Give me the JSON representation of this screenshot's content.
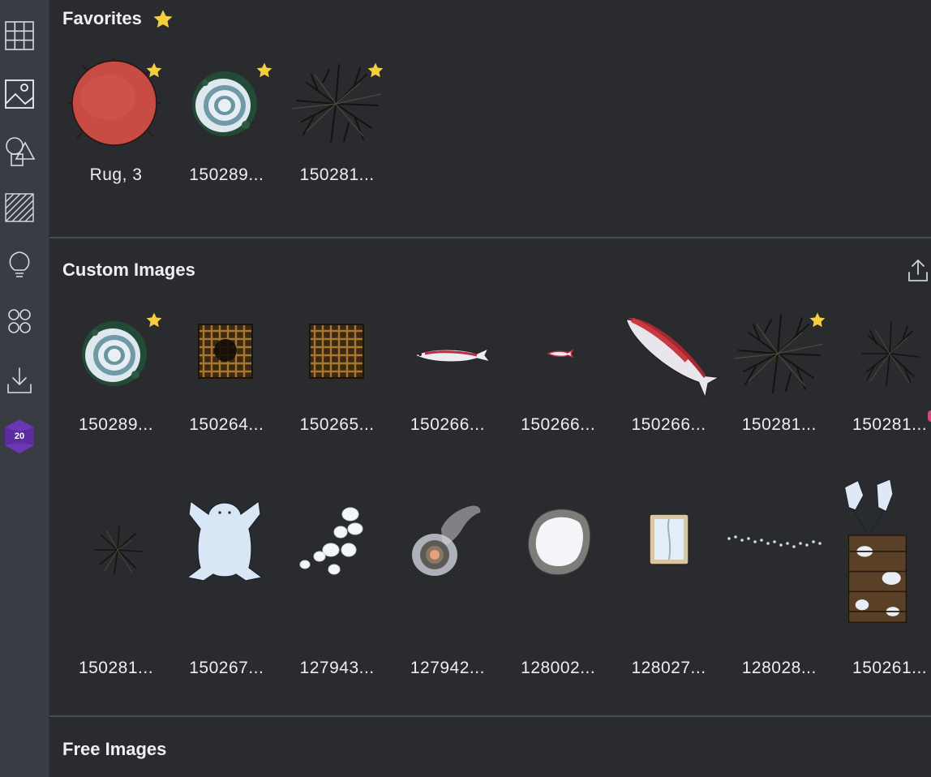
{
  "sidebar": {
    "items": [
      {
        "name": "grid-icon"
      },
      {
        "name": "image-icon"
      },
      {
        "name": "shapes-icon"
      },
      {
        "name": "hatch-pattern-icon"
      },
      {
        "name": "lightbulb-icon"
      },
      {
        "name": "circles-icon"
      },
      {
        "name": "download-icon"
      }
    ],
    "badge": "20"
  },
  "favorites": {
    "title": "Favorites",
    "items": [
      {
        "label": "Rug, 3",
        "icon": "red-rug",
        "favorite": true
      },
      {
        "label": "150289...",
        "icon": "snowy-bush",
        "favorite": true
      },
      {
        "label": "150281...",
        "icon": "dead-tree",
        "favorite": true
      }
    ]
  },
  "custom_images": {
    "title": "Custom Images",
    "upload_icon": "upload-icon",
    "items": [
      {
        "label": "150289...",
        "icon": "snowy-bush",
        "favorite": true
      },
      {
        "label": "150264...",
        "icon": "wooden-grate-hole",
        "favorite": false
      },
      {
        "label": "150265...",
        "icon": "wooden-grate",
        "favorite": false
      },
      {
        "label": "150266...",
        "icon": "fish",
        "favorite": false
      },
      {
        "label": "150266...",
        "icon": "small-fish",
        "favorite": false
      },
      {
        "label": "150266...",
        "icon": "large-red-fish",
        "favorite": false
      },
      {
        "label": "150281...",
        "icon": "dead-tree",
        "favorite": true
      },
      {
        "label": "150281...",
        "icon": "dead-tree-small",
        "favorite": false
      },
      {
        "label": "150281...",
        "icon": "dead-shrub",
        "favorite": false
      },
      {
        "label": "150267...",
        "icon": "polar-bear-rug",
        "favorite": false
      },
      {
        "label": "127943...",
        "icon": "snow-rocks",
        "favorite": false
      },
      {
        "label": "127942...",
        "icon": "campfire-smoke",
        "favorite": false
      },
      {
        "label": "128002...",
        "icon": "snow-boulder",
        "favorite": false
      },
      {
        "label": "128027...",
        "icon": "snow-crate",
        "favorite": false
      },
      {
        "label": "128028...",
        "icon": "footprints",
        "favorite": false
      },
      {
        "label": "150261...",
        "icon": "sled-cart",
        "favorite": false
      }
    ]
  },
  "free_images": {
    "title": "Free Images"
  },
  "colors": {
    "background": "#2a2b2f",
    "sidebar": "#3a3c43",
    "star": "#f3cf3e",
    "badge": "#5b2ba0"
  }
}
